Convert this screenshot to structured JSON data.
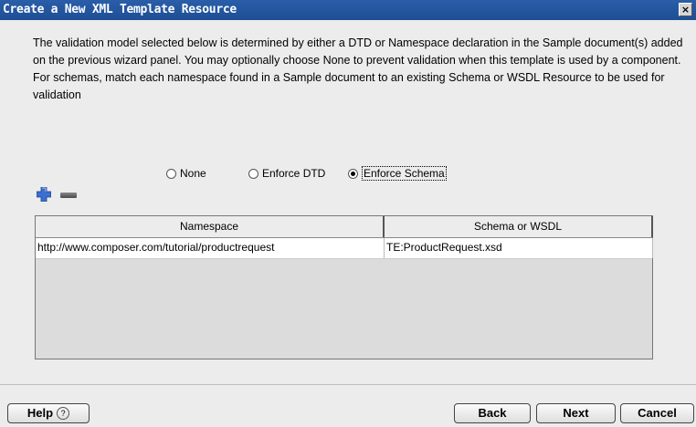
{
  "dialog": {
    "title": "Create a New XML Template Resource",
    "close_label": "×"
  },
  "description": "The validation model selected below is determined by either a DTD or Namespace declaration in the Sample document(s) added on the previous wizard panel.  You may optionally choose None to prevent validation when this template is used by a component.  For schemas, match each namespace found in a Sample document to an existing Schema or WSDL Resource to be used for validation",
  "validation": {
    "options": [
      "None",
      "Enforce DTD",
      "Enforce Schema"
    ],
    "selected": "Enforce Schema"
  },
  "table": {
    "columns": [
      "Namespace",
      "Schema or WSDL"
    ],
    "rows": [
      [
        "http://www.composer.com/tutorial/productrequest",
        "TE:ProductRequest.xsd"
      ]
    ]
  },
  "buttons": {
    "help": "Help",
    "back": "Back",
    "next": "Next",
    "cancel": "Cancel"
  },
  "colors": {
    "titlebar": "#1d4e96",
    "add_icon": "#3b6fd0"
  }
}
